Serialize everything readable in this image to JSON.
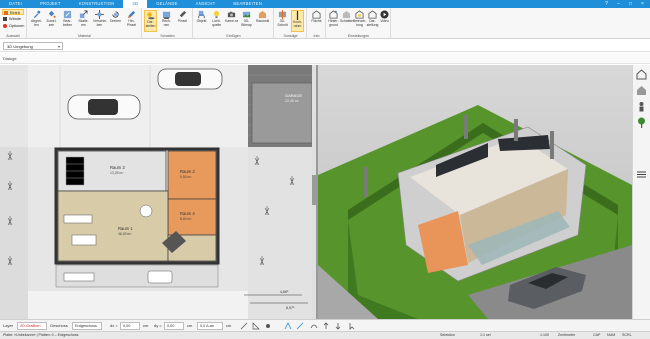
{
  "tabs": [
    {
      "label": "DATEI",
      "active": false
    },
    {
      "label": "PROJEKT",
      "active": false
    },
    {
      "label": "KONSTRUKTION",
      "active": false
    },
    {
      "label": "3D",
      "active": true
    },
    {
      "label": "GELÄNDE",
      "active": false
    },
    {
      "label": "ANSICHT",
      "active": false
    },
    {
      "label": "BEARBEITEN",
      "active": false
    }
  ],
  "ribbon": {
    "auswahl": {
      "items": [
        "Eintrit",
        "Wände",
        "Optionen"
      ],
      "group_label": "Auswahl"
    },
    "material": {
      "items": [
        "Abgrei-fen",
        "Zuwei-sen",
        "Bear-beiten",
        "Skalie-ren",
        "Verschie-ben",
        "Drehen",
        "Hin-Pinsel"
      ],
      "group_label": "Material"
    },
    "schatten": {
      "items": [
        "Dar-stellen",
        "Rech-nen",
        "Pinsel"
      ],
      "group_label": "Schatten"
    },
    "einfuegen": {
      "items": [
        "Objekt",
        "Licht-quelle",
        "Kame-ra",
        "3D-Bitmap",
        "Raumstil"
      ],
      "group_label": "Einfügen"
    },
    "sonstige": {
      "items": [
        "3D-Schnitt",
        "Koch-rahm"
      ],
      "group_label": "Sonstige"
    },
    "info": {
      "items": [
        "Fläche"
      ],
      "group_label": "Info"
    },
    "einstellungen": {
      "items": [
        "Hinter-grund",
        "Schatten",
        "Beleuch-tung",
        "Dar-stellung",
        "Video"
      ],
      "group_label": "Einstellungen"
    }
  },
  "view_select": {
    "value": "3D  Umgebung"
  },
  "dialog_row": {
    "label": "Dialoge"
  },
  "plan": {
    "garage_label": "GARAGE",
    "garage_area": "22,45 m²",
    "rooms": [
      {
        "name": "Raum 3",
        "area": "13,28 m²"
      },
      {
        "name": "Raum 2",
        "area": "9,50 m²"
      },
      {
        "name": "Raum 4",
        "area": "8,84 m²"
      },
      {
        "name": "Raum 1",
        "area": "46,49 m²"
      }
    ],
    "dim_a": "4,66⁵",
    "dim_b": "8,97⁵"
  },
  "bottom_toolbar": {
    "layer_label": "Layer",
    "layer_value": "2D-Grafiken",
    "geschoss_label": "Geschoss",
    "geschoss_value": "Erdgeschoss",
    "dx_label": "dx =",
    "dx_value": "0,00",
    "dx_unit": "cm",
    "dy_label": "dy =",
    "dy_value": "0,00",
    "dy_unit": "cm",
    "dz_value": "0,0 Δ ab",
    "dz_unit": "cm"
  },
  "status": {
    "left": "Platte: «Unbekannt»  |  Platten: 0 – Erdgeschoss",
    "selection": "Selektion",
    "count": "1:1  sel",
    "scale": "1:100",
    "unit": "Zentimeter",
    "cap": "CAP",
    "num": "NUM",
    "scrl": "SCRL"
  },
  "colors": {
    "accent": "#1e8fd8",
    "ribbon_bg": "#f7f7f7",
    "selected_bg": "#fde9a8",
    "room_orange": "#e89a5c",
    "grass": "#3f7f1f"
  }
}
